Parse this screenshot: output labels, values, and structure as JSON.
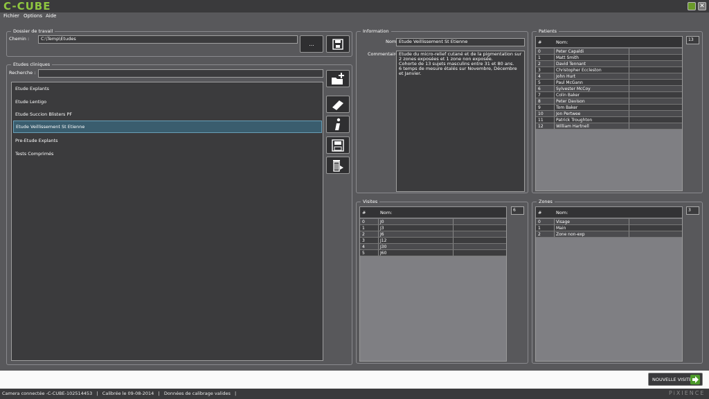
{
  "app": {
    "title": "C-CUBE",
    "brand": "PiXIENCE"
  },
  "menu": [
    "Fichier",
    "Options",
    "Aide"
  ],
  "workdir": {
    "title": "Dossier de travail",
    "path_label": "Chemin :",
    "path": "C:\\Temp\\Etudes",
    "browse_label": "..."
  },
  "studies": {
    "title": "Etudes cliniques",
    "search_label": "Recherche :",
    "search_value": "",
    "items": [
      "Etude Explants",
      "Etude Lentigo",
      "Etude Succion Blisters PF",
      "Etude Veillissement St Etienne",
      "Pre-Etude Explants",
      "Tests Comprimés"
    ],
    "selected_index": 3
  },
  "info": {
    "title": "Information",
    "name_label": "Nom",
    "name": "Etude Veillissement St Etienne",
    "comment_label": "Commentaire",
    "comment": "Etude du micro-relief cutané et de la pigmentation sur 2 zones exposées et 1 zone non exposée.\nCohorte de 13 sujets masculins entre 31 et 80 ans.\n6 temps de mesure étalés sur Novembre, Décembre et Janvier."
  },
  "patients": {
    "title": "Patients",
    "count": "13",
    "col_index": "#",
    "col_name": "Nom:",
    "rows": [
      [
        "0",
        "Peter Capaldi"
      ],
      [
        "1",
        "Matt Smith"
      ],
      [
        "2",
        "David Tennant"
      ],
      [
        "3",
        "Christopher Eccleston"
      ],
      [
        "4",
        "John Hurt"
      ],
      [
        "5",
        "Paul McGann"
      ],
      [
        "6",
        "Sylvester McCoy"
      ],
      [
        "7",
        "Colin Baker"
      ],
      [
        "8",
        "Peter Davison"
      ],
      [
        "9",
        "Tom Baker"
      ],
      [
        "10",
        "Jon Pertwee"
      ],
      [
        "11",
        "Patrick Troughton"
      ],
      [
        "12",
        "William Hartnell"
      ]
    ]
  },
  "visits": {
    "title": "Visites",
    "count": "6",
    "col_index": "#",
    "col_name": "Nom:",
    "rows": [
      [
        "0",
        "J0"
      ],
      [
        "1",
        "J3"
      ],
      [
        "2",
        "J6"
      ],
      [
        "3",
        "J12"
      ],
      [
        "4",
        "J30"
      ],
      [
        "5",
        "J60"
      ]
    ]
  },
  "zones": {
    "title": "Zones",
    "count": "3",
    "col_index": "#",
    "col_name": "Nom:",
    "rows": [
      [
        "0",
        "Visage"
      ],
      [
        "1",
        "Main"
      ],
      [
        "2",
        "Zone non-exp"
      ]
    ]
  },
  "actions": {
    "new_visit": "NOUVELLE VISITE"
  },
  "status": "Camera connectée -C-CUBE-102514453   |   Calibrée le 09-08-2014   |   Données de calibrage valides   |",
  "colors": {
    "accent": "#8fc640",
    "selected": "#3a5d6e",
    "panel": "#58585b"
  }
}
